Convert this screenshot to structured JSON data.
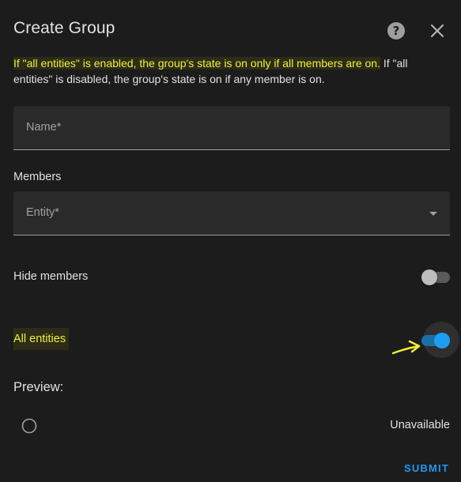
{
  "dialog": {
    "title": "Create Group",
    "help_icon": "question-circle-icon",
    "close_icon": "close-icon"
  },
  "description": {
    "highlighted": "If \"all entities\" is enabled, the group's state is on only if all members are on.",
    "rest": " If \"all entities\" is disabled, the group's state is on if any member is on."
  },
  "fields": {
    "name_label": "Name*",
    "members_label": "Members",
    "entity_label": "Entity*"
  },
  "toggles": {
    "hide_members": {
      "label": "Hide members",
      "checked": false
    },
    "all_entities": {
      "label": "All entities",
      "checked": true
    }
  },
  "preview": {
    "title": "Preview:",
    "icon": "circle-outline-icon",
    "state": "Unavailable"
  },
  "actions": {
    "submit_label": "SUBMIT"
  },
  "colors": {
    "background": "#1c1c1c",
    "accent": "#2196f3",
    "highlight": "#f3ee3c"
  }
}
